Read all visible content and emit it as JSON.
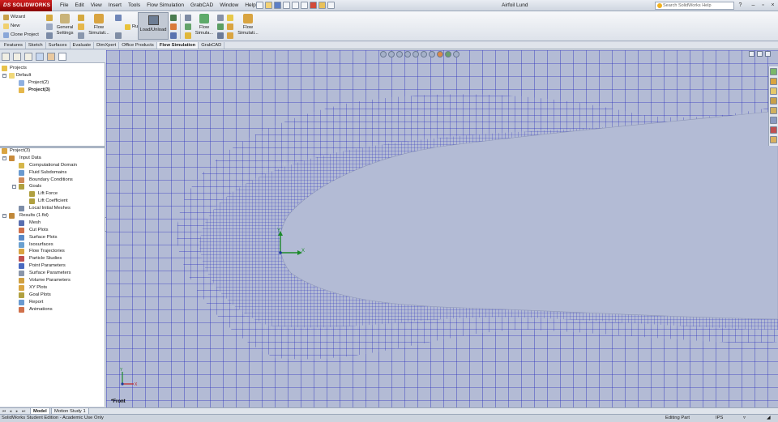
{
  "app": {
    "brand_prefix": "DS",
    "brand": "SOLIDWORKS",
    "document_title": "Airfoil Lund",
    "search_placeholder": "Search SolidWorks Help"
  },
  "menu": [
    "File",
    "Edit",
    "View",
    "Insert",
    "Tools",
    "Flow Simulation",
    "GrabCAD",
    "Window",
    "Help"
  ],
  "ribbon": {
    "wizard": "Wizard",
    "new": "New",
    "clone_project": "Clone Project",
    "general_settings_1": "General",
    "general_settings_2": "Settings",
    "flow_simulation_1": "Flow",
    "flow_simulation_2": "Simulati...",
    "run": "Run",
    "load_unload": "Load/Unload",
    "flow_sim_b_1": "Flow",
    "flow_sim_b_2": "Simula...",
    "flow_sim_c_1": "Flow",
    "flow_sim_c_2": "Simulati..."
  },
  "tabs": [
    "Features",
    "Sketch",
    "Surfaces",
    "Evaluate",
    "DimXpert",
    "Office Products",
    "Flow Simulation",
    "GrabCAD"
  ],
  "active_tab": "Flow Simulation",
  "projects_tree": {
    "root": "Projects",
    "default": "Default",
    "items": [
      "Project(2)",
      "Project(3)"
    ],
    "active_item": "Project(3)"
  },
  "analysis_tree": {
    "root": "Project(3)",
    "input_data": "Input Data",
    "input_children": [
      "Computational Domain",
      "Fluid Subdomains",
      "Boundary Conditions"
    ],
    "goals": "Goals",
    "goals_children": [
      "Lift Force",
      "Lift Coefficient"
    ],
    "local_meshes": "Local Initial Meshes",
    "results": "Results (1.fld)",
    "results_children": [
      "Mesh",
      "Cut Plots",
      "Surface Plots",
      "Isosurfaces",
      "Flow Trajectories",
      "Particle Studies",
      "Point Parameters",
      "Surface Parameters",
      "Volume Parameters",
      "XY Plots",
      "Goal Plots",
      "Report",
      "Animations"
    ]
  },
  "viewport": {
    "view_label": "*Front",
    "triad_x": "X",
    "triad_y": "Y",
    "small_triad_x": "X",
    "small_triad_y": "Y",
    "colors": {
      "background": "#ffffff",
      "fluid_domain": "#b3bbd5",
      "mesh_line": "#2a2fbc",
      "airfoil": "#b3bbd5"
    }
  },
  "bottom_tabs": [
    "Model",
    "Motion Study 1"
  ],
  "active_bottom_tab": "Model",
  "status": {
    "left": "SolidWorks Student Edition - Academic Use Only",
    "mode": "Editing Part",
    "units": "IPS"
  }
}
